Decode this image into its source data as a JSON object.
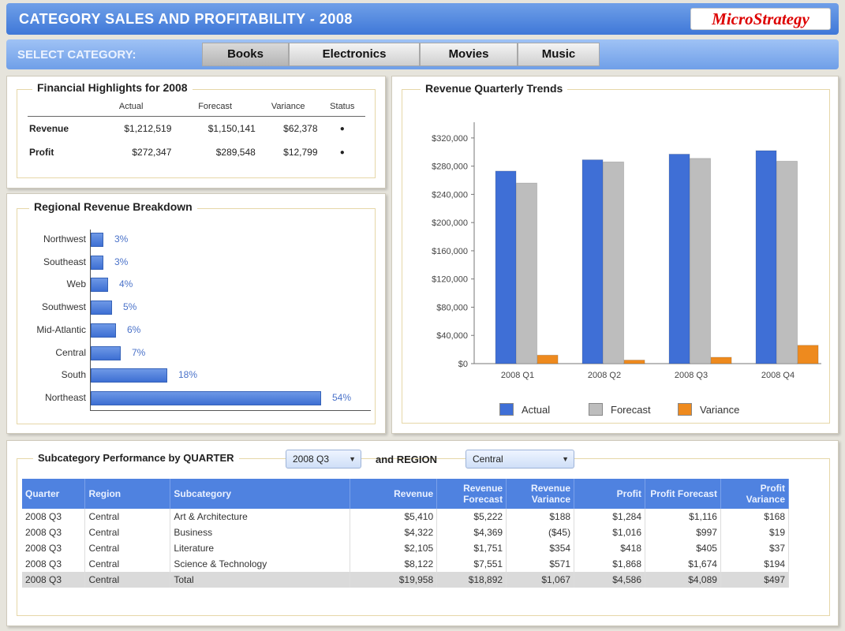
{
  "header": {
    "title": "CATEGORY SALES AND PROFITABILITY - 2008",
    "logo_text": "MicroStrategy"
  },
  "category_bar": {
    "label": "SELECT CATEGORY:",
    "tabs": [
      {
        "label": "Books",
        "active": true
      },
      {
        "label": "Electronics",
        "active": false
      },
      {
        "label": "Movies",
        "active": false
      },
      {
        "label": "Music",
        "active": false
      }
    ]
  },
  "financial": {
    "title": "Financial Highlights for 2008",
    "columns": [
      "Actual",
      "Forecast",
      "Variance",
      "Status"
    ],
    "rows": [
      {
        "label": "Revenue",
        "actual": "$1,212,519",
        "forecast": "$1,150,141",
        "variance": "$62,378",
        "status": "●"
      },
      {
        "label": "Profit",
        "actual": "$272,347",
        "forecast": "$289,548",
        "variance": "$12,799",
        "status": "●"
      }
    ]
  },
  "regional": {
    "title": "Regional Revenue Breakdown",
    "rows": [
      {
        "region": "Northwest",
        "pct": "3%",
        "value": 3
      },
      {
        "region": "Southeast",
        "pct": "3%",
        "value": 3
      },
      {
        "region": "Web",
        "pct": "4%",
        "value": 4
      },
      {
        "region": "Southwest",
        "pct": "5%",
        "value": 5
      },
      {
        "region": "Mid-Atlantic",
        "pct": "6%",
        "value": 6
      },
      {
        "region": "Central",
        "pct": "7%",
        "value": 7
      },
      {
        "region": "South",
        "pct": "18%",
        "value": 18
      },
      {
        "region": "Northeast",
        "pct": "54%",
        "value": 54
      }
    ]
  },
  "revenue_trends": {
    "title": "Revenue Quarterly Trends"
  },
  "chart_data": {
    "type": "bar",
    "categories": [
      "2008 Q1",
      "2008 Q2",
      "2008 Q3",
      "2008 Q4"
    ],
    "series": [
      {
        "name": "Actual",
        "values": [
          273000,
          289000,
          297000,
          302000
        ],
        "color": "#3f6fd6"
      },
      {
        "name": "Forecast",
        "values": [
          256000,
          286000,
          291000,
          287000
        ],
        "color": "#bdbdbd"
      },
      {
        "name": "Variance",
        "values": [
          12000,
          5000,
          9000,
          26000
        ],
        "color": "#ee8a1e"
      }
    ],
    "y_ticks": [
      "$0",
      "$40,000",
      "$80,000",
      "$120,000",
      "$160,000",
      "$200,000",
      "$240,000",
      "$280,000",
      "$320,000"
    ],
    "ylim": [
      0,
      340000
    ],
    "legend_position": "bottom"
  },
  "subcategory": {
    "title": "Subcategory Performance by QUARTER",
    "quarter_value": "2008 Q3",
    "region_label": "and REGION",
    "region_value": "Central",
    "columns": [
      "Quarter",
      "Region",
      "Subcategory",
      "Revenue",
      "Revenue Forecast",
      "Revenue Variance",
      "Profit",
      "Profit Forecast",
      "Profit Variance"
    ],
    "rows": [
      [
        "2008 Q3",
        "Central",
        "Art & Architecture",
        "$5,410",
        "$5,222",
        "$188",
        "$1,284",
        "$1,116",
        "$168"
      ],
      [
        "2008 Q3",
        "Central",
        "Business",
        "$4,322",
        "$4,369",
        "($45)",
        "$1,016",
        "$997",
        "$19"
      ],
      [
        "2008 Q3",
        "Central",
        "Literature",
        "$2,105",
        "$1,751",
        "$354",
        "$418",
        "$405",
        "$37"
      ],
      [
        "2008 Q3",
        "Central",
        "Science & Technology",
        "$8,122",
        "$7,551",
        "$571",
        "$1,868",
        "$1,674",
        "$194"
      ]
    ],
    "total": [
      "2008 Q3",
      "Central",
      "Total",
      "$19,958",
      "$18,892",
      "$1,067",
      "$4,586",
      "$4,089",
      "$497"
    ]
  }
}
